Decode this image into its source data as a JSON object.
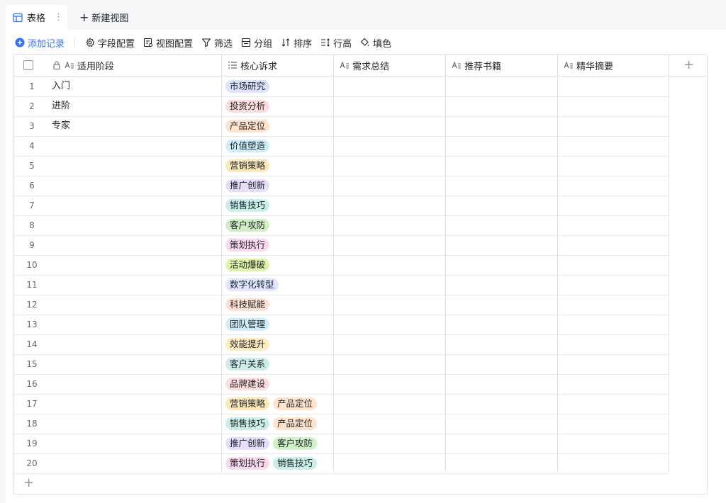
{
  "tabs": {
    "active_label": "表格",
    "new_view_label": "新建视图"
  },
  "toolbar": {
    "add_record": "添加记录",
    "field_config": "字段配置",
    "view_config": "视图配置",
    "filter": "筛选",
    "group": "分组",
    "sort": "排序",
    "row_height": "行高",
    "fill_color": "填色"
  },
  "columns": {
    "stage": "适用阶段",
    "appeal": "核心诉求",
    "summary": "需求总结",
    "books": "推荐书籍",
    "digest": "精华摘要"
  },
  "tag_colors": {
    "市场研究": "#dbe4ff",
    "投资分析": "#ffdcdc",
    "产品定位": "#fee3cd",
    "价值塑造": "#cdeefa",
    "营销策略": "#fde9b8",
    "推广创新": "#e7defd",
    "销售技巧": "#c9efe8",
    "客户攻防": "#d0f0c6",
    "策划执行": "#fbd9ec",
    "活动爆破": "#dff3a9",
    "数字化转型": "#e0e6ff",
    "科技赋能": "#ffe2d3",
    "团队管理": "#cfedfb",
    "效能提升": "#feebc0",
    "客户关系": "#cdeee8",
    "品牌建设": "#ffdde0"
  },
  "rows": [
    {
      "num": "1",
      "stage": "入门",
      "tags": [
        "市场研究"
      ]
    },
    {
      "num": "2",
      "stage": "进阶",
      "tags": [
        "投资分析"
      ]
    },
    {
      "num": "3",
      "stage": "专家",
      "tags": [
        "产品定位"
      ]
    },
    {
      "num": "4",
      "stage": "",
      "tags": [
        "价值塑造"
      ]
    },
    {
      "num": "5",
      "stage": "",
      "tags": [
        "营销策略"
      ]
    },
    {
      "num": "6",
      "stage": "",
      "tags": [
        "推广创新"
      ]
    },
    {
      "num": "7",
      "stage": "",
      "tags": [
        "销售技巧"
      ]
    },
    {
      "num": "8",
      "stage": "",
      "tags": [
        "客户攻防"
      ]
    },
    {
      "num": "9",
      "stage": "",
      "tags": [
        "策划执行"
      ]
    },
    {
      "num": "10",
      "stage": "",
      "tags": [
        "活动爆破"
      ]
    },
    {
      "num": "11",
      "stage": "",
      "tags": [
        "数字化转型"
      ]
    },
    {
      "num": "12",
      "stage": "",
      "tags": [
        "科技赋能"
      ]
    },
    {
      "num": "13",
      "stage": "",
      "tags": [
        "团队管理"
      ]
    },
    {
      "num": "14",
      "stage": "",
      "tags": [
        "效能提升"
      ]
    },
    {
      "num": "15",
      "stage": "",
      "tags": [
        "客户关系"
      ]
    },
    {
      "num": "16",
      "stage": "",
      "tags": [
        "品牌建设"
      ]
    },
    {
      "num": "17",
      "stage": "",
      "tags": [
        "营销策略",
        "产品定位"
      ]
    },
    {
      "num": "18",
      "stage": "",
      "tags": [
        "销售技巧",
        "产品定位"
      ]
    },
    {
      "num": "19",
      "stage": "",
      "tags": [
        "推广创新",
        "客户攻防"
      ]
    },
    {
      "num": "20",
      "stage": "",
      "tags": [
        "策划执行",
        "销售技巧"
      ]
    }
  ]
}
